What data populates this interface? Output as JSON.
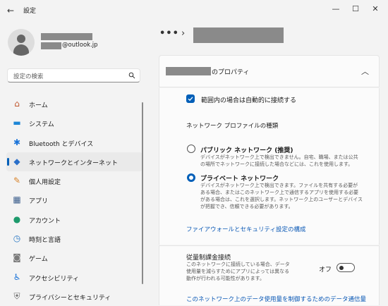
{
  "window": {
    "title": "設定",
    "back_icon": "←",
    "minimize_icon": "—",
    "maximize_icon": "☐",
    "close_icon": "✕"
  },
  "account": {
    "email_suffix": "@outlook.jp"
  },
  "search": {
    "placeholder": "設定の検索"
  },
  "nav": {
    "items": [
      {
        "label": "ホーム",
        "icon": "home-icon",
        "glyph": "⌂",
        "color": "#c0542b"
      },
      {
        "label": "システム",
        "icon": "system-icon",
        "glyph": "▬",
        "color": "#1d86d6"
      },
      {
        "label": "Bluetooth とデバイス",
        "icon": "bluetooth-icon",
        "glyph": "✱",
        "color": "#1a73d8"
      },
      {
        "label": "ネットワークとインターネット",
        "icon": "wifi-icon",
        "glyph": "◆",
        "color": "#2a6fc9"
      },
      {
        "label": "個人用設定",
        "icon": "brush-icon",
        "glyph": "✎",
        "color": "#d8832b"
      },
      {
        "label": "アプリ",
        "icon": "apps-icon",
        "glyph": "▦",
        "color": "#3b5e8c"
      },
      {
        "label": "アカウント",
        "icon": "account-icon",
        "glyph": "●",
        "color": "#1d9a6c"
      },
      {
        "label": "時刻と言語",
        "icon": "clock-globe-icon",
        "glyph": "◷",
        "color": "#2a78c4"
      },
      {
        "label": "ゲーム",
        "icon": "gamepad-icon",
        "glyph": "◙",
        "color": "#7a7a7a"
      },
      {
        "label": "アクセシビリティ",
        "icon": "accessibility-icon",
        "glyph": "♿",
        "color": "#1a73d8"
      },
      {
        "label": "プライバシーとセキュリティ",
        "icon": "shield-icon",
        "glyph": "⛨",
        "color": "#6b6b6b"
      }
    ],
    "selected_index": 3
  },
  "breadcrumb": {
    "more": "•••",
    "separator": "›"
  },
  "card": {
    "title_suffix": "のプロパティ",
    "collapse_glyph": "︿",
    "auto_connect": {
      "label": "範囲内の場合は自動的に接続する",
      "checked": true
    },
    "profile_section_title": "ネットワーク プロファイルの種類",
    "profiles": [
      {
        "title": "パブリック ネットワーク (推奨)",
        "desc": "デバイスがネットワーク上で検出できません。自宅、職場、または公共の場所でネットワークに接続した場合などには、これを使用します。",
        "selected": false
      },
      {
        "title": "プライベート ネットワーク",
        "desc": "デバイスがネットワーク上で検出できます。ファイルを共有する必要がある場合、またはこのネットワーク上で通信するアプリを使用する必要がある場合は、これを選択します。ネットワーク上のユーザーとデバイスが把握でき、信頼できる必要があります。",
        "selected": true
      }
    ],
    "firewall_link": "ファイアウォールとセキュリティ設定の構成",
    "metered": {
      "title": "従量制課金接続",
      "desc": "このネットワークに接続している場合、データ使用量を減らすためにアプリによっては異なる動作が行われる可能性があります。",
      "state_label": "オフ",
      "on": false
    },
    "data_limit_link": "このネットワーク上のデータ使用量を制御するためのデータ通信量"
  },
  "accent_color": "#005fb8"
}
